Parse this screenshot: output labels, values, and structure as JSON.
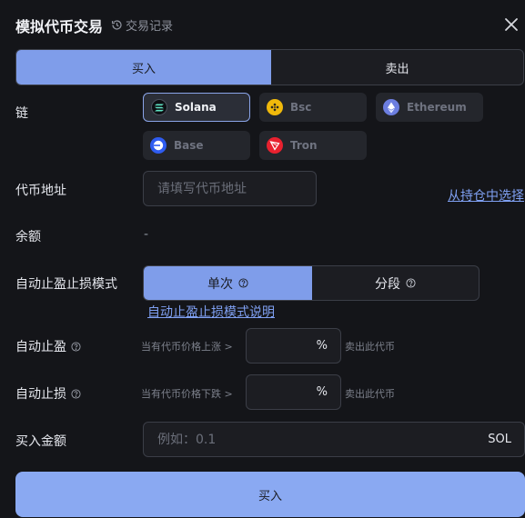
{
  "header": {
    "title": "模拟代币交易",
    "history_label": "交易记录"
  },
  "tabs": {
    "buy": "买入",
    "sell": "卖出"
  },
  "chain": {
    "label": "链",
    "options": [
      {
        "name": "Solana",
        "selected": true
      },
      {
        "name": "Bsc",
        "selected": false
      },
      {
        "name": "Ethereum",
        "selected": false
      },
      {
        "name": "Base",
        "selected": false
      },
      {
        "name": "Tron",
        "selected": false
      }
    ]
  },
  "token_address": {
    "label": "代币地址",
    "placeholder": "请填写代币地址",
    "pick_link": "从持仓中选择"
  },
  "balance": {
    "label": "余额",
    "value": "-"
  },
  "auto_mode": {
    "label": "自动止盈止损模式",
    "single": "单次",
    "segmented": "分段",
    "selected": "单次",
    "help_link": "自动止盈止损模式说明"
  },
  "take_profit": {
    "label": "自动止盈",
    "condition": "当有代币价格上涨 >",
    "unit": "%",
    "suffix": "卖出此代币"
  },
  "stop_loss": {
    "label": "自动止损",
    "condition": "当有代币价格下跌 >",
    "unit": "%",
    "suffix": "卖出此代币"
  },
  "buy_amount": {
    "label": "买入金额",
    "placeholder": "例如：0.1",
    "currency": "SOL"
  },
  "submit": {
    "label": "买入"
  },
  "colors": {
    "accent": "#7f9dea",
    "background": "#141519",
    "link": "#7fa0f2"
  }
}
